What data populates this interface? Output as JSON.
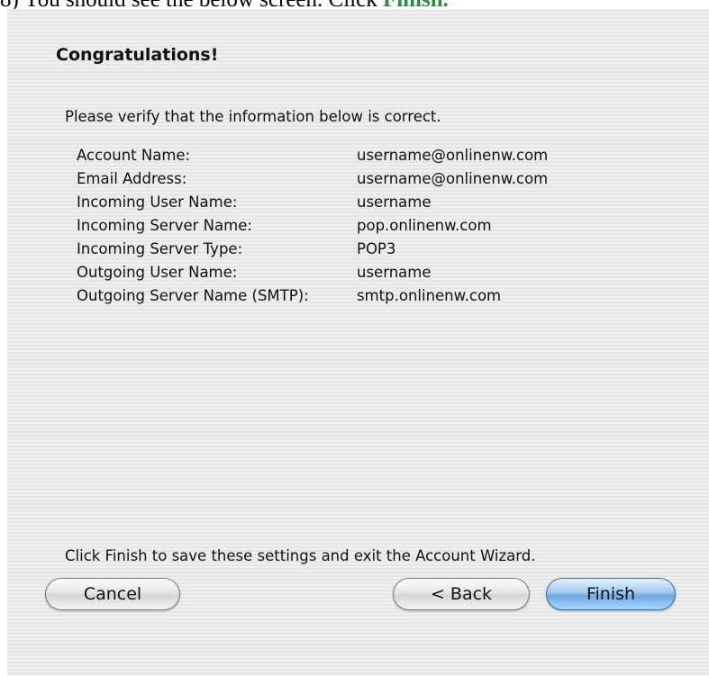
{
  "instruction": {
    "prefix": "8) You should see the below screen. Click ",
    "highlight": "Finish."
  },
  "dialog": {
    "heading": "Congratulations!",
    "verify_text": "Please verify that the information below is correct.",
    "info_rows": [
      {
        "label": "Account Name:",
        "value": "username@onlinenw.com"
      },
      {
        "label": "Email Address:",
        "value": "username@onlinenw.com"
      },
      {
        "label": "Incoming User Name:",
        "value": "username"
      },
      {
        "label": "Incoming Server Name:",
        "value": "pop.onlinenw.com"
      },
      {
        "label": "Incoming Server Type:",
        "value": "POP3"
      },
      {
        "label": "Outgoing User Name:",
        "value": "username"
      },
      {
        "label": "Outgoing Server Name (SMTP):",
        "value": "smtp.onlinenw.com"
      }
    ],
    "finish_text": "Click Finish to save these settings and exit the Account Wizard.",
    "buttons": {
      "cancel": "Cancel",
      "back": "< Back",
      "finish": "Finish"
    }
  },
  "colors": {
    "highlight": "#2f8a4a",
    "dialog_background": "#ececec",
    "default_button": "#6fa9e6"
  }
}
